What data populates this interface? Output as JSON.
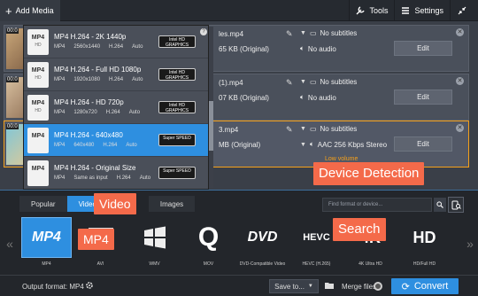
{
  "toolbar": {
    "add_media": "Add Media",
    "tools": "Tools",
    "settings": "Settings"
  },
  "files": [
    {
      "time": "00:0",
      "name_tail": "les.mp4",
      "size": "65 KB (Original)",
      "subtitles": "No subtitles",
      "audio": "No audio",
      "edit": "Edit"
    },
    {
      "time": "00:0",
      "name_tail": "(1).mp4",
      "size": "07 KB (Original)",
      "subtitles": "No subtitles",
      "audio": "No audio",
      "edit": "Edit"
    },
    {
      "time": "00:0",
      "name_tail": "3.mp4",
      "size": "MB (Original)",
      "subtitles": "No subtitles",
      "audio": "AAC 256 Kbps Stereo",
      "edit": "Edit",
      "warning": "Low volume"
    }
  ],
  "presets": [
    {
      "title": "MP4 H.264 - 2K 1440p",
      "sub": [
        "MP4",
        "2560x1440",
        "H.264",
        "Auto"
      ],
      "badge": "Intel HD GRAPHICS",
      "icon": "MP4",
      "icon_sub": "HD"
    },
    {
      "title": "MP4 H.264 - Full HD 1080p",
      "sub": [
        "MP4",
        "1920x1080",
        "H.264",
        "Auto"
      ],
      "badge": "Intel HD GRAPHICS",
      "icon": "MP4",
      "icon_sub": "HD"
    },
    {
      "title": "MP4 H.264 - HD 720p",
      "sub": [
        "MP4",
        "1280x720",
        "H.264",
        "Auto"
      ],
      "badge": "Intel HD GRAPHICS",
      "icon": "MP4",
      "icon_sub": "HD"
    },
    {
      "title": "MP4 H.264 - 640x480",
      "sub": [
        "MP4",
        "640x480",
        "H.264",
        "Auto"
      ],
      "badge": "Super SPEED",
      "icon": "MP4",
      "icon_sub": ""
    },
    {
      "title": "MP4 H.264 - Original Size",
      "sub": [
        "MP4",
        "Same as input",
        "H.264",
        "Auto"
      ],
      "badge": "Super SPEED",
      "icon": "MP4",
      "icon_sub": ""
    }
  ],
  "format_tabs": [
    "Popular",
    "Video",
    "Images"
  ],
  "search": {
    "placeholder": "Find format or device..."
  },
  "formats": [
    {
      "label": "MP4",
      "glyph": "MP4"
    },
    {
      "label": "AVI",
      "glyph": ""
    },
    {
      "label": "WMV",
      "glyph": ""
    },
    {
      "label": "MOV",
      "glyph": "Q"
    },
    {
      "label": "DVD-Compatible Video",
      "glyph": "DVD"
    },
    {
      "label": "HEVC (H.265)",
      "glyph": "HEVC"
    },
    {
      "label": "4K Ultra HD",
      "glyph": "4K"
    },
    {
      "label": "HD/Full HD",
      "glyph": "HD"
    }
  ],
  "bottom": {
    "output_format": "Output format: MP4",
    "save_to": "Save to...",
    "merge_files": "Merge files",
    "convert": "Convert"
  },
  "callouts": {
    "video": "Video",
    "mp4": "MP4",
    "device_detection": "Device Detection",
    "search": "Search"
  },
  "colors": {
    "accent": "#2e8fe0",
    "callout": "#f46a4a",
    "warning": "#f5a01a"
  }
}
